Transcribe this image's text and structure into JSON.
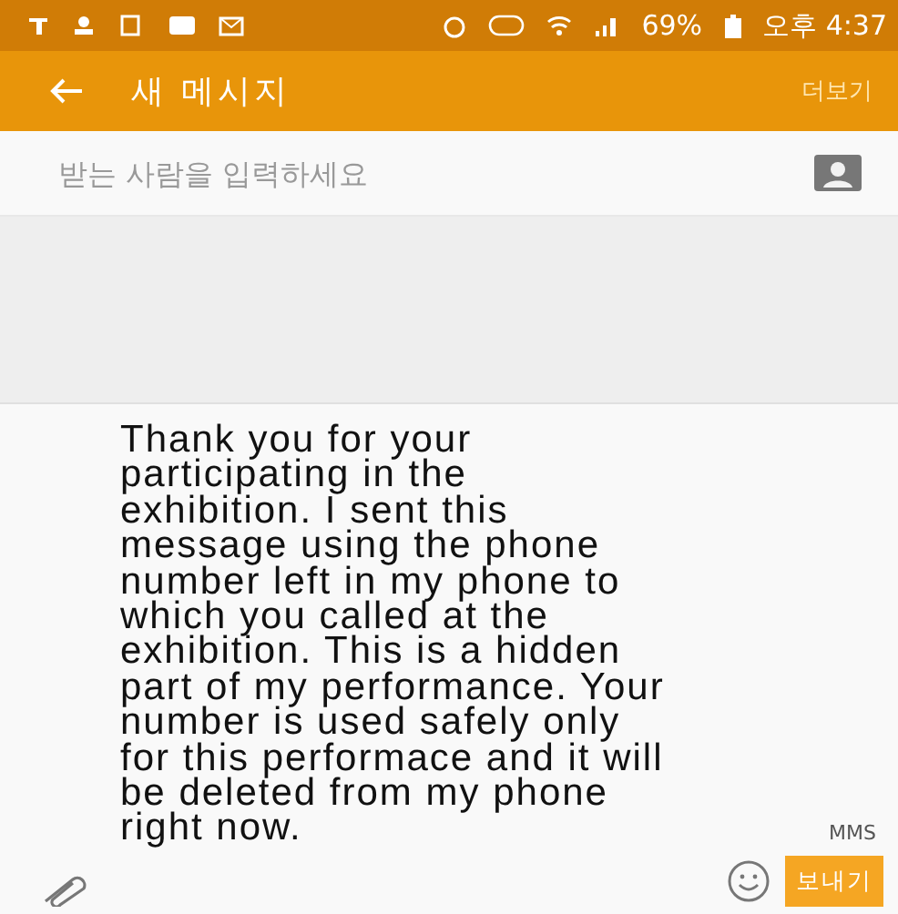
{
  "status_bar": {
    "battery": "69%",
    "time": "오후 4:37"
  },
  "app_bar": {
    "title": "새 메시지",
    "menu": "더보기"
  },
  "recipient": {
    "placeholder": "받는 사람을 입력하세요"
  },
  "message": {
    "value": "Thank you for your participating in the exhibition. I sent this message using the phone number left in my phone to which you called at the exhibition. This is a hidden part of my performance. Your number is used safely only for this performace and it will be deleted from my phone right now.",
    "type": "MMS"
  },
  "send_button": "보내기"
}
